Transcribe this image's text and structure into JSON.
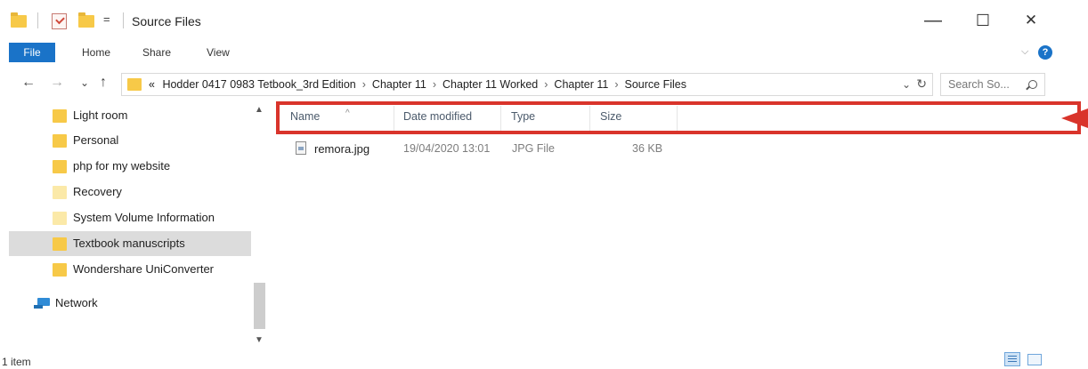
{
  "window": {
    "title": "Source Files",
    "qa_dropdown": "=",
    "minimize": "—",
    "maximize": "☐",
    "close": "✕"
  },
  "ribbon": {
    "tabs": [
      "File",
      "Home",
      "Share",
      "View"
    ],
    "chevron": "⌵",
    "help": "?"
  },
  "nav": {
    "back": "←",
    "forward": "→",
    "recent": "⌄",
    "up": "↑",
    "breadcrumb_overflow": "«",
    "breadcrumbs": [
      "Hodder 0417 0983 Tetbook_3rd Edition",
      "Chapter 11",
      "Chapter 11 Worked",
      "Chapter 11",
      "Source Files"
    ],
    "crumb_separator": "›",
    "address_dropdown": "⌄",
    "refresh": "↻",
    "search_placeholder": "Search So..."
  },
  "sidebar": {
    "items": [
      {
        "label": "Light room",
        "icon": "folder-icon"
      },
      {
        "label": "Personal",
        "icon": "folder-icon"
      },
      {
        "label": "php for my website",
        "icon": "folder-icon"
      },
      {
        "label": "Recovery",
        "icon": "folder-icon"
      },
      {
        "label": "System Volume Information",
        "icon": "folder-icon"
      },
      {
        "label": "Textbook manuscripts",
        "icon": "folder-icon",
        "selected": true
      },
      {
        "label": "Wondershare UniConverter",
        "icon": "folder-icon"
      }
    ],
    "network_label": "Network"
  },
  "columns": {
    "name": "Name",
    "date_modified": "Date modified",
    "type": "Type",
    "size": "Size",
    "sort_indicator": "^"
  },
  "files": [
    {
      "name": "remora.jpg",
      "date_modified": "19/04/2020 13:01",
      "type": "JPG File",
      "size": "36 KB"
    }
  ],
  "status": {
    "item_count": "1 item"
  },
  "colors": {
    "accent": "#1a73c8",
    "highlight": "#d9342b",
    "folder": "#f7c948"
  }
}
